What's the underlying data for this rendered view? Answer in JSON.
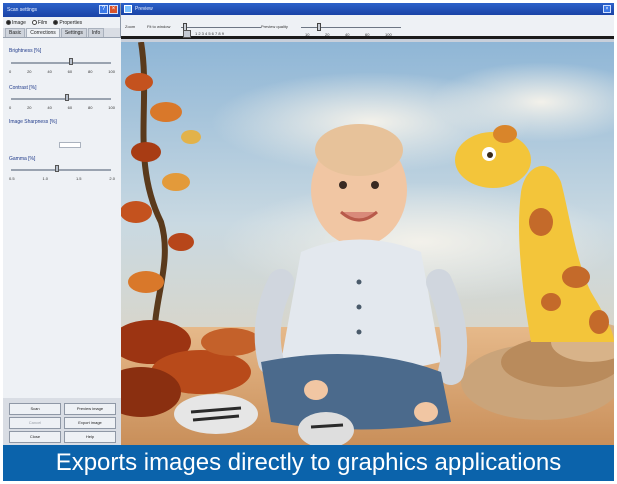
{
  "left_window": {
    "title": "Scan settings",
    "source_options": [
      "Image",
      "Film",
      "Properties"
    ],
    "tabs": [
      "Basic",
      "Corrections",
      "Settings",
      "Info"
    ],
    "groups": [
      {
        "label": "Brightness [%]",
        "ticks": [
          "0",
          "20",
          "40",
          "60",
          "80",
          "100"
        ]
      },
      {
        "label": "Contrast [%]",
        "ticks": [
          "0",
          "20",
          "40",
          "60",
          "80",
          "100"
        ]
      },
      {
        "label": "Image Sharpness [%]",
        "ticks": []
      },
      {
        "label": "Gamma [%]",
        "ticks": [
          "0.5",
          "1.0",
          "1.5",
          "2.0"
        ]
      }
    ],
    "buttons": {
      "scan": "Scan",
      "preview": "Preview image",
      "cancel": "Cancel",
      "export": "Export image",
      "close": "Close",
      "help": "Help"
    }
  },
  "right_window": {
    "title": "Preview",
    "close_glyph": "×",
    "toolbar": {
      "zoom_label": "Zoom",
      "fit_label": "Fit to window",
      "scale_ticks": "1 2 3 4 5 6 7 8 9",
      "preview_label": "Preview quality",
      "quality_ticks": [
        "10",
        "20",
        "40",
        "60",
        "100"
      ]
    }
  },
  "caption": "Exports images directly to graphics applications"
}
